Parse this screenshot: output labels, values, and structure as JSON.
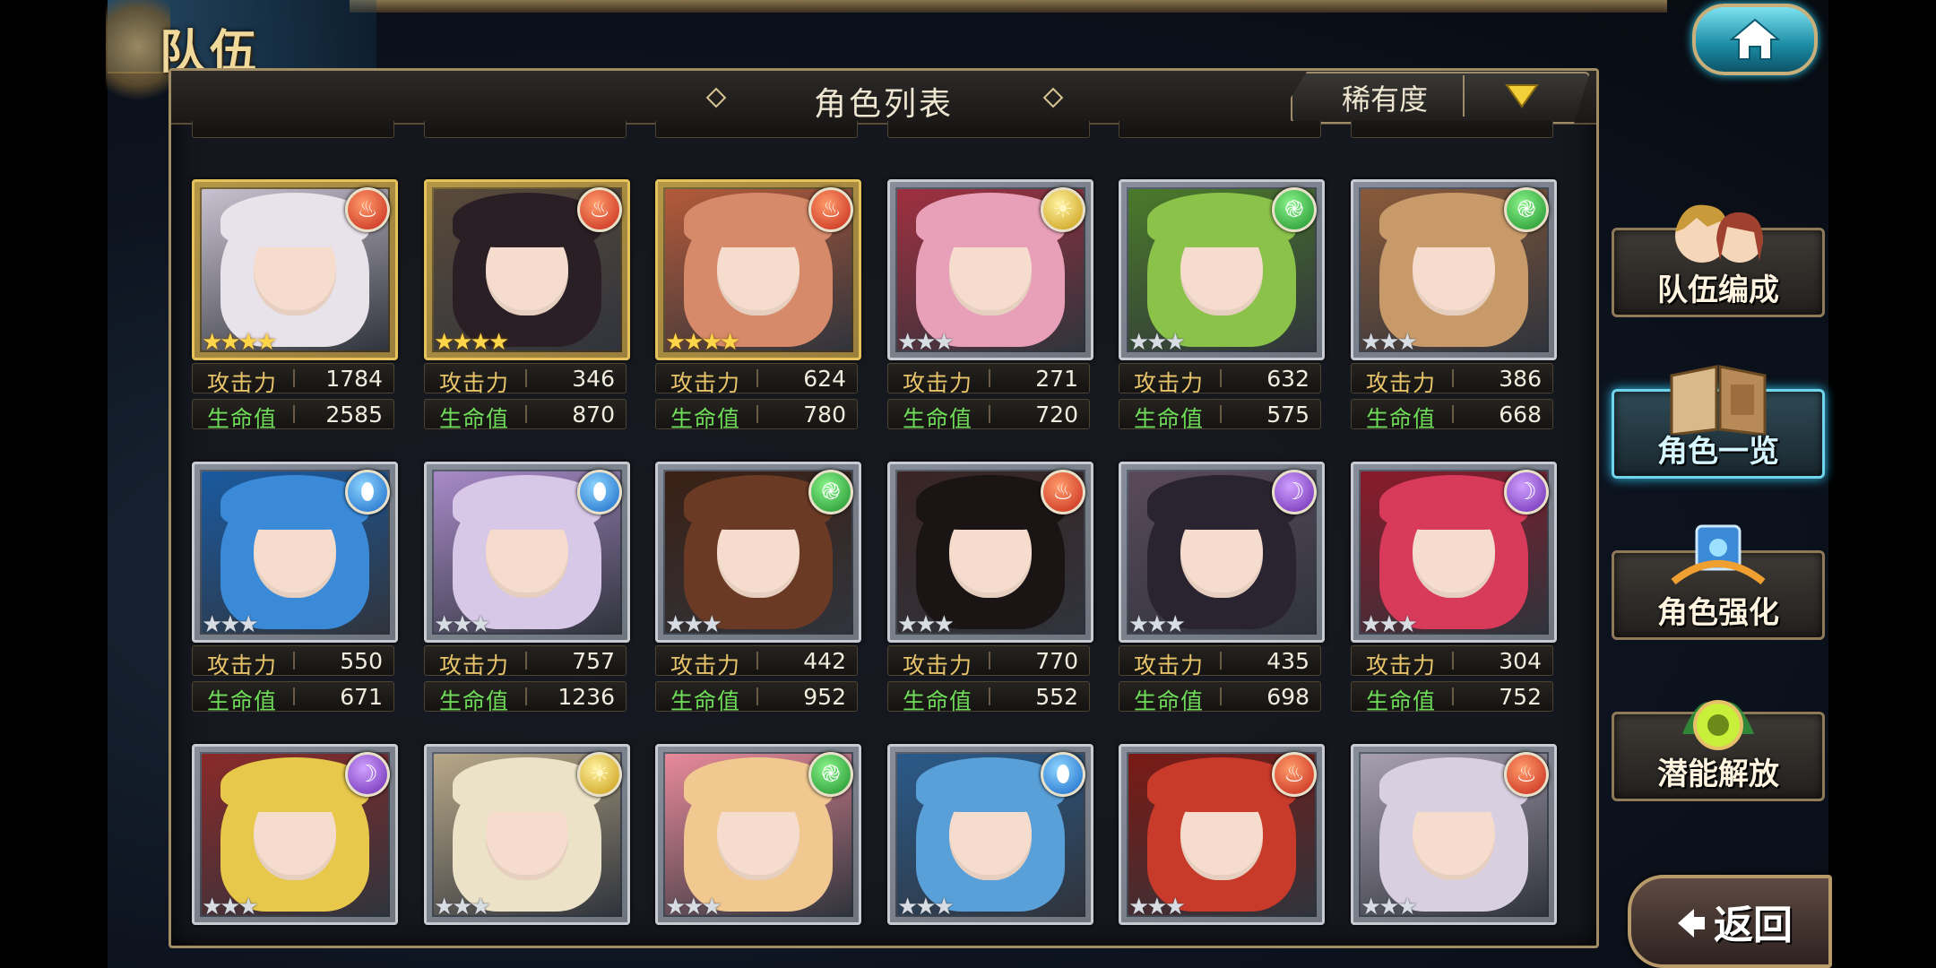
{
  "header": {
    "team_title": "队伍",
    "home_icon": "home-icon"
  },
  "panel": {
    "title": "角色列表",
    "sort_label": "稀有度",
    "sort_icon": "triangle-down-icon"
  },
  "stat_labels": {
    "attack": "攻击力",
    "hp": "生命值"
  },
  "characters": [
    {
      "element": "fire",
      "rarity": 4,
      "attack": "1784",
      "hp": "2585"
    },
    {
      "element": "fire",
      "rarity": 4,
      "attack": "346",
      "hp": "870"
    },
    {
      "element": "fire",
      "rarity": 4,
      "attack": "624",
      "hp": "780"
    },
    {
      "element": "light",
      "rarity": 3,
      "attack": "271",
      "hp": "720"
    },
    {
      "element": "wind",
      "rarity": 3,
      "attack": "632",
      "hp": "575"
    },
    {
      "element": "wind",
      "rarity": 3,
      "attack": "386",
      "hp": "668"
    },
    {
      "element": "water",
      "rarity": 3,
      "attack": "550",
      "hp": "671"
    },
    {
      "element": "water",
      "rarity": 3,
      "attack": "757",
      "hp": "1236"
    },
    {
      "element": "wind",
      "rarity": 3,
      "attack": "442",
      "hp": "952"
    },
    {
      "element": "fire",
      "rarity": 3,
      "attack": "770",
      "hp": "552"
    },
    {
      "element": "dark",
      "rarity": 3,
      "attack": "435",
      "hp": "698"
    },
    {
      "element": "dark",
      "rarity": 3,
      "attack": "304",
      "hp": "752"
    },
    {
      "element": "dark",
      "rarity": 3
    },
    {
      "element": "light",
      "rarity": 3
    },
    {
      "element": "wind",
      "rarity": 3
    },
    {
      "element": "water",
      "rarity": 3
    },
    {
      "element": "fire",
      "rarity": 3
    },
    {
      "element": "fire",
      "rarity": 3
    }
  ],
  "nav": {
    "team_formation": "队伍编成",
    "character_list": "角色一览",
    "character_enhance": "角色强化",
    "potential_release": "潜能解放"
  },
  "back_label": "返回",
  "colors": {
    "gold_frame": "#e6c35a",
    "silver_frame": "#c8ccd2",
    "attack_label": "#e8c46a",
    "hp_label": "#6fdc5a",
    "active_nav_glow": "#2ec6f0"
  }
}
